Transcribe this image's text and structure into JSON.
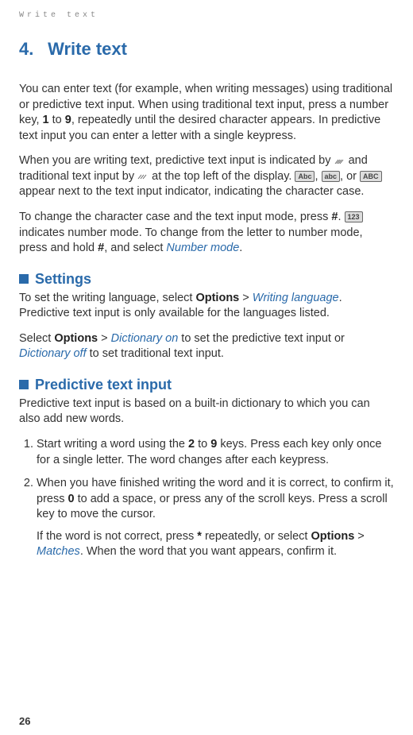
{
  "running_header": "Write text",
  "chapter": {
    "number": "4.",
    "title": "Write text"
  },
  "intro1_a": "You can enter text (for example, when writing messages) using traditional or predictive text input. When using traditional text input, press a number key, ",
  "intro1_b": "1",
  "intro1_c": " to ",
  "intro1_d": "9",
  "intro1_e": ", repeatedly until the desired character appears. In predictive text input you can enter a letter with a single keypress.",
  "intro2_a": "When you are writing text, predictive text input is indicated by ",
  "intro2_b": " and traditional text input by ",
  "intro2_c": " at the top left of the display. ",
  "intro2_d": ", ",
  "intro2_e": ", or ",
  "intro2_f": " appear next to the text input indicator, indicating the character case.",
  "intro3_a": "To change the character case and the text input mode, press ",
  "intro3_b": "#",
  "intro3_c": ". ",
  "intro3_d": " indicates number mode. To change from the letter to number mode, press and hold ",
  "intro3_e": "#",
  "intro3_f": ", and select ",
  "intro3_g": "Number mode",
  "intro3_h": ".",
  "settings": {
    "title": "Settings",
    "p1_a": "To set the writing language, select ",
    "p1_b": "Options",
    "p1_c": " > ",
    "p1_d": "Writing language",
    "p1_e": ". Predictive text input is only available for the languages listed.",
    "p2_a": "Select ",
    "p2_b": "Options",
    "p2_c": " > ",
    "p2_d": "Dictionary on",
    "p2_e": " to set the predictive text input or ",
    "p2_f": "Dictionary off",
    "p2_g": " to set traditional text input."
  },
  "predictive": {
    "title": "Predictive text input",
    "lead": "Predictive text input is based on a built-in dictionary to which you can also add new words.",
    "step1_a": "Start writing a word using the ",
    "step1_b": "2",
    "step1_c": " to ",
    "step1_d": "9",
    "step1_e": " keys. Press each key only once for a single letter. The word changes after each keypress.",
    "step2_a": "When you have finished writing the word and it is correct, to confirm it, press ",
    "step2_b": "0",
    "step2_c": " to add a space, or press any of the scroll keys. Press a scroll key to move the cursor.",
    "step2_sub_a": "If the word is not correct, press ",
    "step2_sub_b": "*",
    "step2_sub_c": " repeatedly, or select ",
    "step2_sub_d": "Options",
    "step2_sub_e": " > ",
    "step2_sub_f": "Matches",
    "step2_sub_g": ". When the word that you want appears, confirm it."
  },
  "icons": {
    "Abc": "Abc",
    "abc": "abc",
    "ABC": "ABC",
    "123": "123"
  },
  "page_number": "26"
}
